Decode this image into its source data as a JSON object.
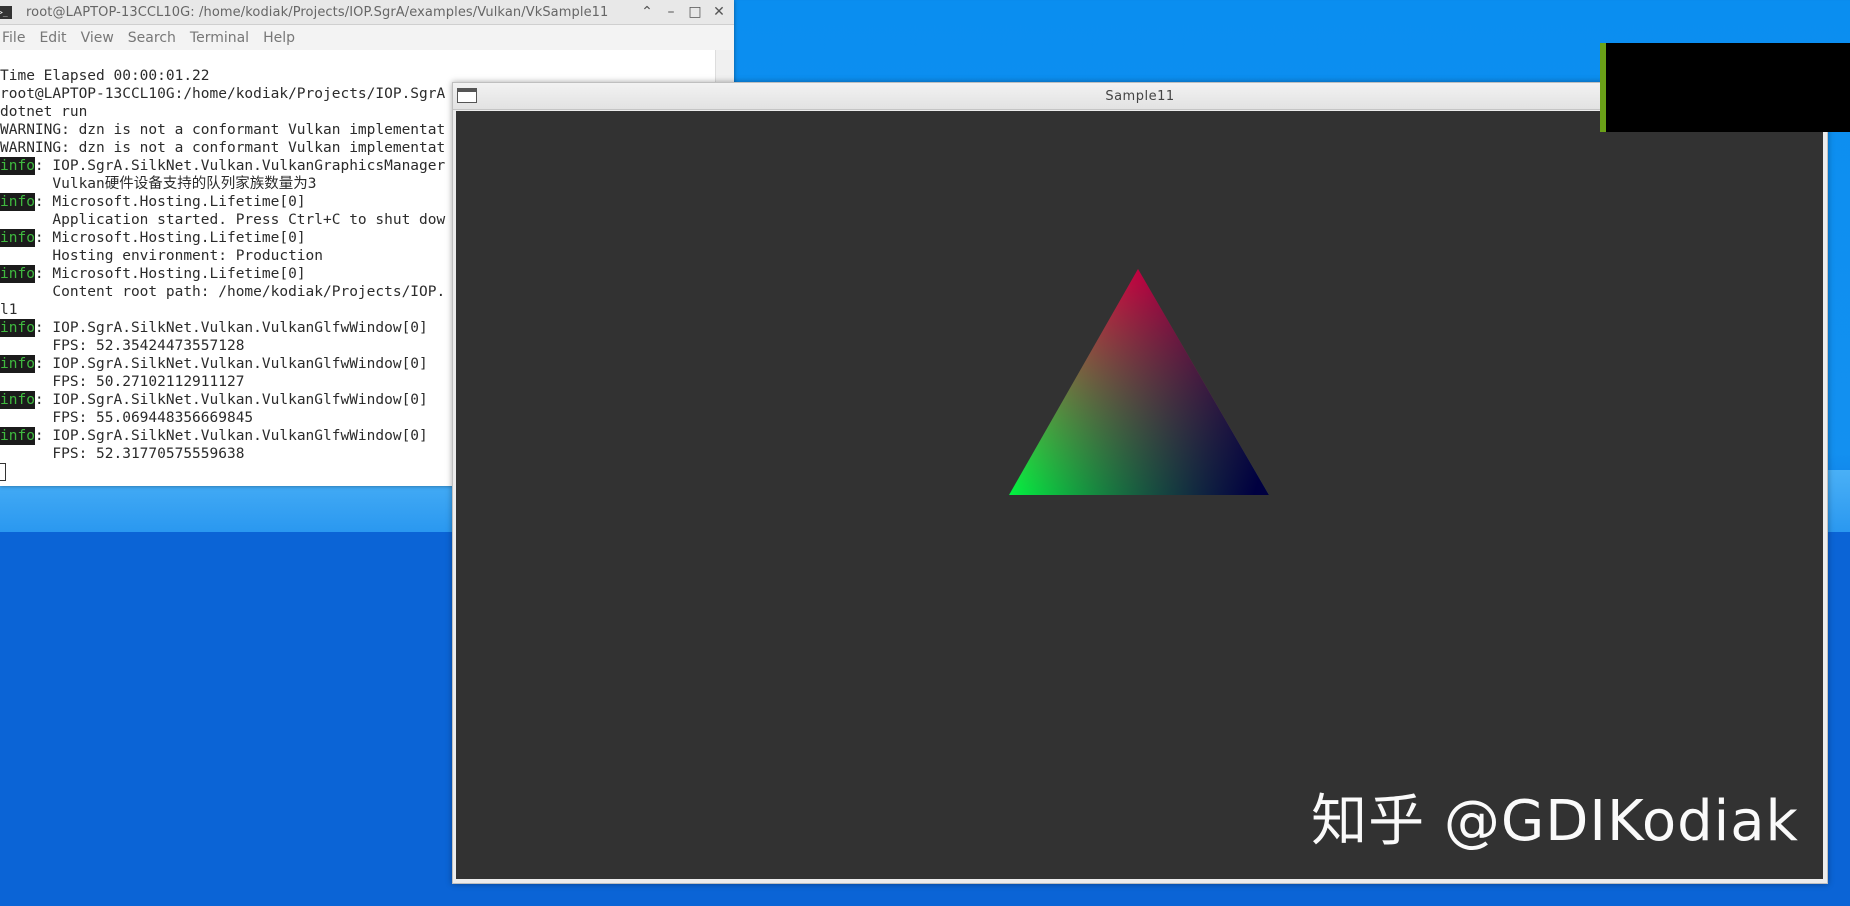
{
  "terminal": {
    "title": "root@LAPTOP-13CCL10G: /home/kodiak/Projects/IOP.SgrA/examples/Vulkan/VkSample11",
    "menu": [
      "File",
      "Edit",
      "View",
      "Search",
      "Terminal",
      "Help"
    ],
    "lines": [
      {
        "tag": "",
        "text": "Time Elapsed 00:00:01.22"
      },
      {
        "tag": "",
        "text": "root@LAPTOP-13CCL10G:/home/kodiak/Projects/IOP.SgrA"
      },
      {
        "tag": "",
        "text": "dotnet run"
      },
      {
        "tag": "",
        "text": "WARNING: dzn is not a conformant Vulkan implementat"
      },
      {
        "tag": "",
        "text": "WARNING: dzn is not a conformant Vulkan implementat"
      },
      {
        "tag": "info",
        "text": ": IOP.SgrA.SilkNet.Vulkan.VulkanGraphicsManager"
      },
      {
        "tag": "",
        "text": "      Vulkan硬件设备支持的队列家族数量为3"
      },
      {
        "tag": "info",
        "text": ": Microsoft.Hosting.Lifetime[0]"
      },
      {
        "tag": "",
        "text": "      Application started. Press Ctrl+C to shut dow"
      },
      {
        "tag": "info",
        "text": ": Microsoft.Hosting.Lifetime[0]"
      },
      {
        "tag": "",
        "text": "      Hosting environment: Production"
      },
      {
        "tag": "info",
        "text": ": Microsoft.Hosting.Lifetime[0]"
      },
      {
        "tag": "",
        "text": "      Content root path: /home/kodiak/Projects/IOP."
      },
      {
        "tag": "",
        "text": "l1"
      },
      {
        "tag": "info",
        "text": ": IOP.SgrA.SilkNet.Vulkan.VulkanGlfwWindow[0]"
      },
      {
        "tag": "",
        "text": "      FPS: 52.35424473557128"
      },
      {
        "tag": "info",
        "text": ": IOP.SgrA.SilkNet.Vulkan.VulkanGlfwWindow[0]"
      },
      {
        "tag": "",
        "text": "      FPS: 50.27102112911127"
      },
      {
        "tag": "info",
        "text": ": IOP.SgrA.SilkNet.Vulkan.VulkanGlfwWindow[0]"
      },
      {
        "tag": "",
        "text": "      FPS: 55.069448356669845"
      },
      {
        "tag": "info",
        "text": ": IOP.SgrA.SilkNet.Vulkan.VulkanGlfwWindow[0]"
      },
      {
        "tag": "",
        "text": "      FPS: 52.31770575559638"
      }
    ],
    "info_tag": "info"
  },
  "sample_window": {
    "title": "Sample11",
    "watermark": "知乎 @GDIKodiak",
    "triangle_colors": {
      "top": "#ff0040",
      "left": "#00ff40",
      "right": "#000040"
    }
  }
}
